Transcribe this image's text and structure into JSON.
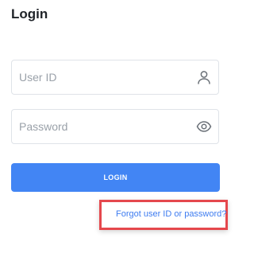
{
  "page": {
    "title": "Login"
  },
  "form": {
    "user_id_placeholder": "User ID",
    "user_id_value": "",
    "password_placeholder": "Password",
    "password_value": "",
    "login_label": "LOGIN",
    "forgot_label": "Forgot user ID or password?"
  },
  "icons": {
    "user_field": "user-icon",
    "password_field": "eye-icon"
  },
  "colors": {
    "accent": "#4285f4",
    "link": "#3e7cf0",
    "highlight": "#e5484d"
  }
}
